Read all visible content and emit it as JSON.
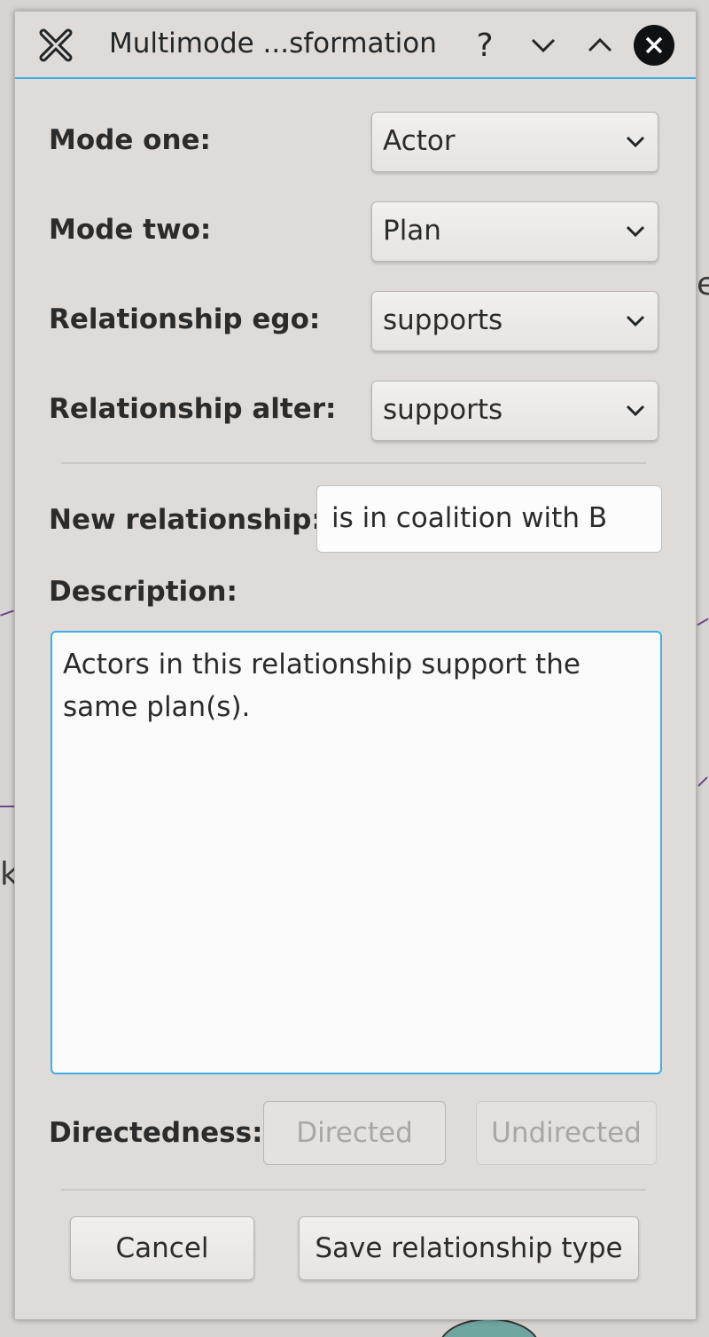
{
  "window": {
    "title": "Multimode ...sformation",
    "help_glyph": "?",
    "icons": {
      "app": "app-x-icon",
      "minimize": "chevron-down-icon",
      "maximize": "chevron-up-icon",
      "close": "close-icon"
    },
    "accent_color": "#3daee9"
  },
  "form": {
    "mode_one": {
      "label": "Mode one:",
      "value": "Actor"
    },
    "mode_two": {
      "label": "Mode two:",
      "value": "Plan"
    },
    "relationship_ego": {
      "label": "Relationship ego:",
      "value": "supports"
    },
    "relationship_alter": {
      "label": "Relationship alter:",
      "value": "supports"
    },
    "new_relationship": {
      "label": "New relationship:",
      "value": "is in coalition with B"
    },
    "description": {
      "label": "Description:",
      "value": "Actors in this relationship support the same plan(s)."
    },
    "directedness": {
      "label": "Directedness:",
      "directed": "Directed",
      "undirected": "Undirected"
    }
  },
  "footer": {
    "cancel": "Cancel",
    "save": "Save relationship type"
  }
}
